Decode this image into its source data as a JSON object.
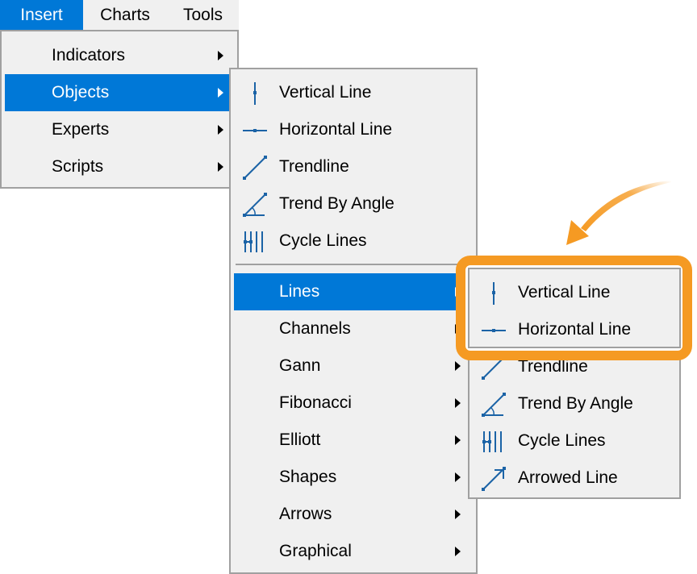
{
  "menubar": {
    "items": [
      {
        "label": "Insert",
        "active": true
      },
      {
        "label": "Charts",
        "active": false
      },
      {
        "label": "Tools",
        "active": false
      }
    ]
  },
  "insert_menu": {
    "items": [
      {
        "label": "Indicators",
        "has_submenu": true
      },
      {
        "label": "Objects",
        "has_submenu": true,
        "active": true
      },
      {
        "label": "Experts",
        "has_submenu": true
      },
      {
        "label": "Scripts",
        "has_submenu": true
      }
    ]
  },
  "objects_menu": {
    "items": [
      {
        "label": "Vertical Line",
        "icon": "vertical-line-icon"
      },
      {
        "label": "Horizontal Line",
        "icon": "horizontal-line-icon"
      },
      {
        "label": "Trendline",
        "icon": "trendline-icon"
      },
      {
        "label": "Trend By Angle",
        "icon": "trend-by-angle-icon"
      },
      {
        "label": "Cycle Lines",
        "icon": "cycle-lines-icon"
      }
    ],
    "groups": [
      {
        "label": "Lines",
        "has_submenu": true,
        "active": true
      },
      {
        "label": "Channels",
        "has_submenu": true
      },
      {
        "label": "Gann",
        "has_submenu": true
      },
      {
        "label": "Fibonacci",
        "has_submenu": true
      },
      {
        "label": "Elliott",
        "has_submenu": true
      },
      {
        "label": "Shapes",
        "has_submenu": true
      },
      {
        "label": "Arrows",
        "has_submenu": true
      },
      {
        "label": "Graphical",
        "has_submenu": true
      }
    ]
  },
  "lines_menu": {
    "items": [
      {
        "label": "Vertical Line",
        "icon": "vertical-line-icon",
        "highlighted": true
      },
      {
        "label": "Horizontal Line",
        "icon": "horizontal-line-icon",
        "highlighted": true
      },
      {
        "label": "Trendline",
        "icon": "trendline-icon"
      },
      {
        "label": "Trend By Angle",
        "icon": "trend-by-angle-icon"
      },
      {
        "label": "Cycle Lines",
        "icon": "cycle-lines-icon"
      },
      {
        "label": "Arrowed Line",
        "icon": "arrowed-line-icon"
      }
    ]
  },
  "colors": {
    "selection": "#0078d7",
    "menu_bg": "#f0f0f0",
    "menu_border": "#a0a0a0",
    "icon": "#1b63a6",
    "callout": "#f59a23"
  }
}
